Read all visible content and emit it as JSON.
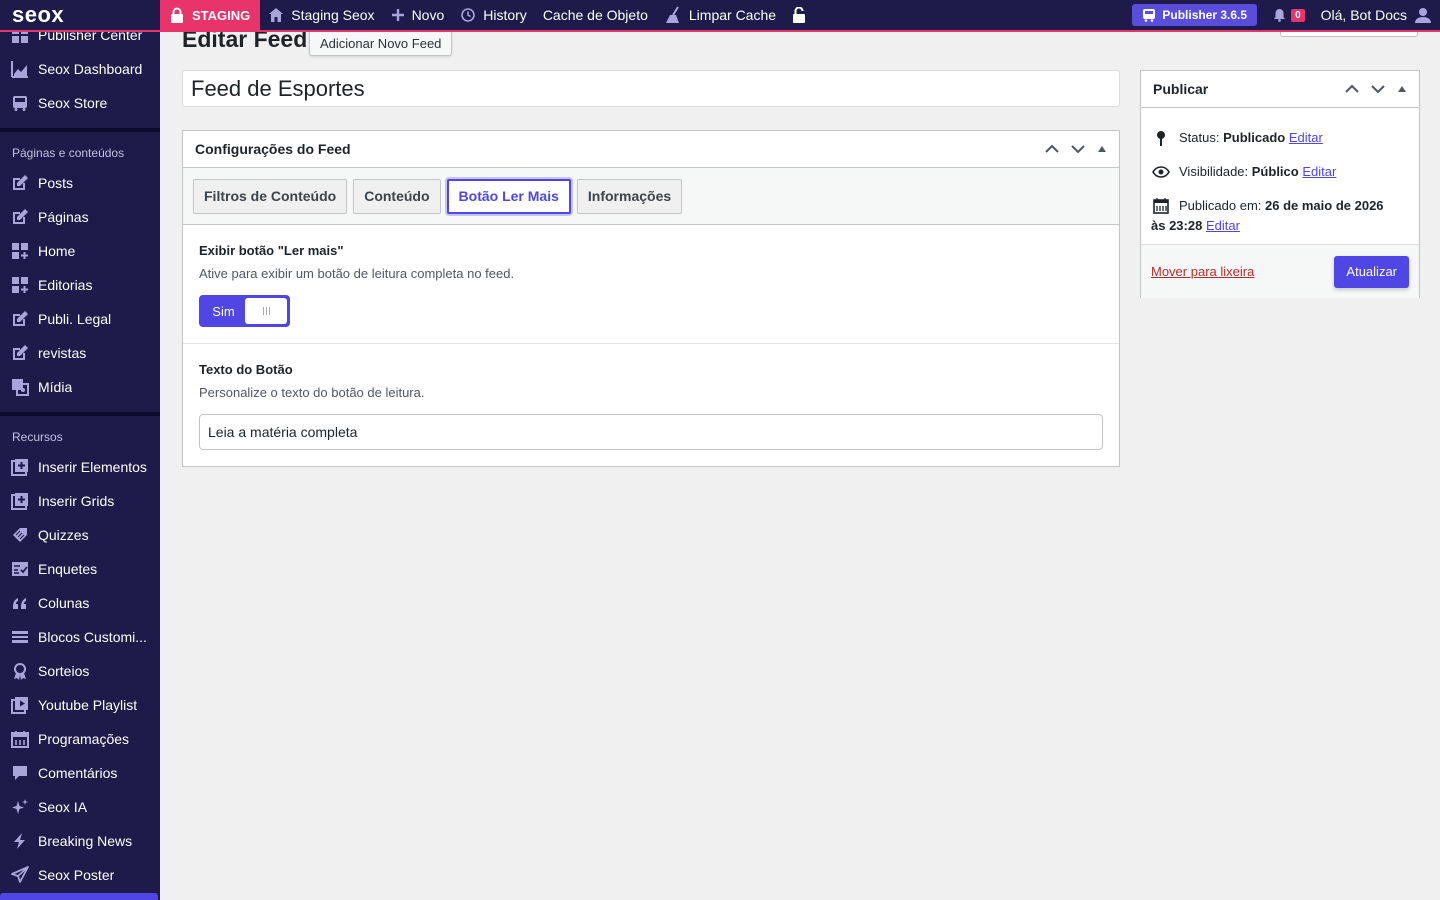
{
  "adminbar": {
    "logo": "seox",
    "staging_label": "STAGING",
    "site_name": "Staging Seox",
    "new_label": "Novo",
    "history_label": "History",
    "object_cache_label": "Cache de Objeto",
    "clear_cache_label": "Limpar Cache",
    "publisher_label": "Publisher 3.6.5",
    "notifications_count": "0",
    "greeting": "Olá, Bot Docs"
  },
  "sidebar": {
    "top_items": [
      {
        "label": "Publisher Center",
        "icon": "grid-icon"
      },
      {
        "label": "Seox Dashboard",
        "icon": "chart-icon"
      },
      {
        "label": "Seox Store",
        "icon": "store-icon"
      }
    ],
    "section1_header": "Páginas e conteúdos",
    "section1_items": [
      {
        "label": "Posts",
        "icon": "edit-icon"
      },
      {
        "label": "Páginas",
        "icon": "edit-icon"
      },
      {
        "label": "Home",
        "icon": "blocks-icon"
      },
      {
        "label": "Editorias",
        "icon": "blocks-icon"
      },
      {
        "label": "Publi. Legal",
        "icon": "edit-icon"
      },
      {
        "label": "revistas",
        "icon": "edit-icon"
      },
      {
        "label": "Mídia",
        "icon": "media-icon"
      }
    ],
    "section2_header": "Recursos",
    "section2_items": [
      {
        "label": "Inserir Elementos",
        "icon": "plus-box-icon"
      },
      {
        "label": "Inserir Grids",
        "icon": "plus-box-icon"
      },
      {
        "label": "Quizzes",
        "icon": "tag-icon"
      },
      {
        "label": "Enquetes",
        "icon": "poll-icon"
      },
      {
        "label": "Colunas",
        "icon": "quote-icon"
      },
      {
        "label": "Blocos Customi...",
        "icon": "list-icon"
      },
      {
        "label": "Sorteios",
        "icon": "award-icon"
      },
      {
        "label": "Youtube Playlist",
        "icon": "playlist-icon"
      },
      {
        "label": "Programações",
        "icon": "calendar-icon"
      },
      {
        "label": "Comentários",
        "icon": "comment-icon"
      },
      {
        "label": "Seox IA",
        "icon": "sparkle-icon"
      },
      {
        "label": "Breaking News",
        "icon": "bolt-icon"
      },
      {
        "label": "Seox Poster",
        "icon": "send-icon"
      }
    ]
  },
  "main": {
    "page_title": "Editar Feed",
    "add_new_label": "Adicionar Novo Feed",
    "title_value": "Feed de Esportes"
  },
  "feed_box": {
    "header": "Configurações do Feed",
    "tabs": [
      {
        "label": "Filtros de Conteúdo",
        "active": false
      },
      {
        "label": "Conteúdo",
        "active": false
      },
      {
        "label": "Botão Ler Mais",
        "active": true
      },
      {
        "label": "Informações",
        "active": false
      }
    ],
    "show_button_label": "Exibir botão \"Ler mais\"",
    "show_button_desc": "Ative para exibir um botão de leitura completa no feed.",
    "toggle_label": "Sim",
    "button_text_label": "Texto do Botão",
    "button_text_desc": "Personalize o texto do botão de leitura.",
    "button_text_value": "Leia a matéria completa"
  },
  "publish_box": {
    "header": "Publicar",
    "status_prefix": "Status:",
    "status_value": "Publicado",
    "visibility_prefix": "Visibilidade:",
    "visibility_value": "Público",
    "published_prefix": "Publicado em:",
    "published_value": "26 de maio de 2026",
    "published_time": "às 23:28",
    "edit_label": "Editar",
    "trash_label": "Mover para lixeira",
    "update_label": "Atualizar"
  },
  "colors": {
    "accent": "#4f46e5",
    "adminbar_bg": "#1e1a4a",
    "staging": "#e8336b"
  }
}
